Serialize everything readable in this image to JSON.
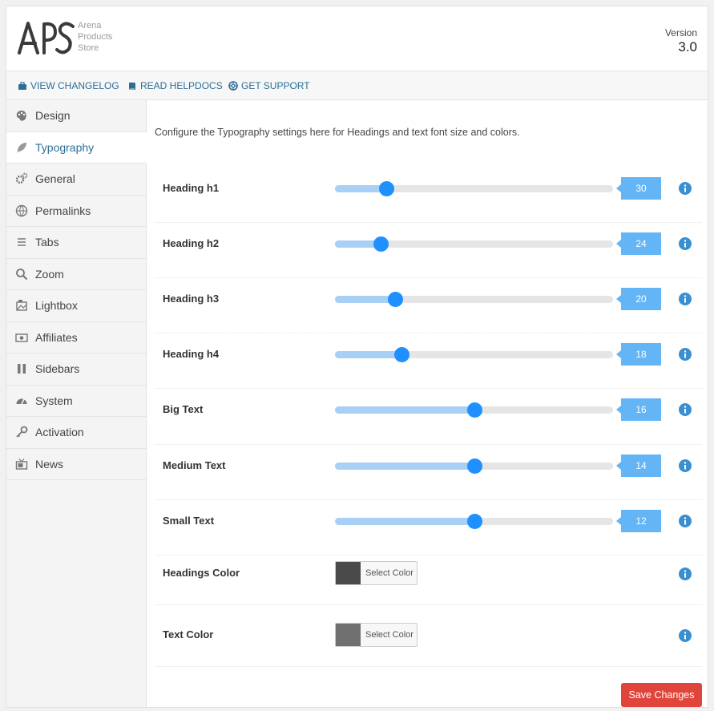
{
  "header": {
    "logo_mark": "APS",
    "logo_lines": [
      "Arena",
      "Products",
      "Store"
    ],
    "version_label": "Version",
    "version_number": "3.0"
  },
  "linkbar": {
    "changelog": "VIEW CHANGELOG",
    "helpdocs": "READ HELPDOCS",
    "support": "GET SUPPORT"
  },
  "sidebar": {
    "items": [
      {
        "label": "Design",
        "icon": "palette-icon"
      },
      {
        "label": "Typography",
        "icon": "feather-icon",
        "active": true
      },
      {
        "label": "General",
        "icon": "cogs-icon"
      },
      {
        "label": "Permalinks",
        "icon": "globe-icon"
      },
      {
        "label": "Tabs",
        "icon": "bars-icon"
      },
      {
        "label": "Zoom",
        "icon": "magnifier-icon"
      },
      {
        "label": "Lightbox",
        "icon": "image-icon"
      },
      {
        "label": "Affiliates",
        "icon": "money-icon"
      },
      {
        "label": "Sidebars",
        "icon": "columns-icon"
      },
      {
        "label": "System",
        "icon": "dashboard-icon"
      },
      {
        "label": "Activation",
        "icon": "key-icon"
      },
      {
        "label": "News",
        "icon": "tv-icon"
      }
    ]
  },
  "main": {
    "description": "Configure the Typography settings here for Headings and text font size and colors.",
    "sliders": [
      {
        "label": "Heading h1",
        "value": "30",
        "fraction": 0.185
      },
      {
        "label": "Heading h2",
        "value": "24",
        "fraction": 0.165
      },
      {
        "label": "Heading h3",
        "value": "20",
        "fraction": 0.215
      },
      {
        "label": "Heading h4",
        "value": "18",
        "fraction": 0.24
      },
      {
        "label": "Big Text",
        "value": "16",
        "fraction": 0.5
      },
      {
        "label": "Medium Text",
        "value": "14",
        "fraction": 0.5
      },
      {
        "label": "Small Text",
        "value": "12",
        "fraction": 0.5
      }
    ],
    "colors": [
      {
        "label": "Headings Color",
        "button_label": "Select Color",
        "color": "#4a4a4a"
      },
      {
        "label": "Text Color",
        "button_label": "Select Color",
        "color": "#707070"
      }
    ],
    "save_label": "Save Changes"
  },
  "theme": {
    "accent": "#1e90ff",
    "value_box": "#64b5f6",
    "save": "#e0443a",
    "info": "#3a8fd0"
  }
}
